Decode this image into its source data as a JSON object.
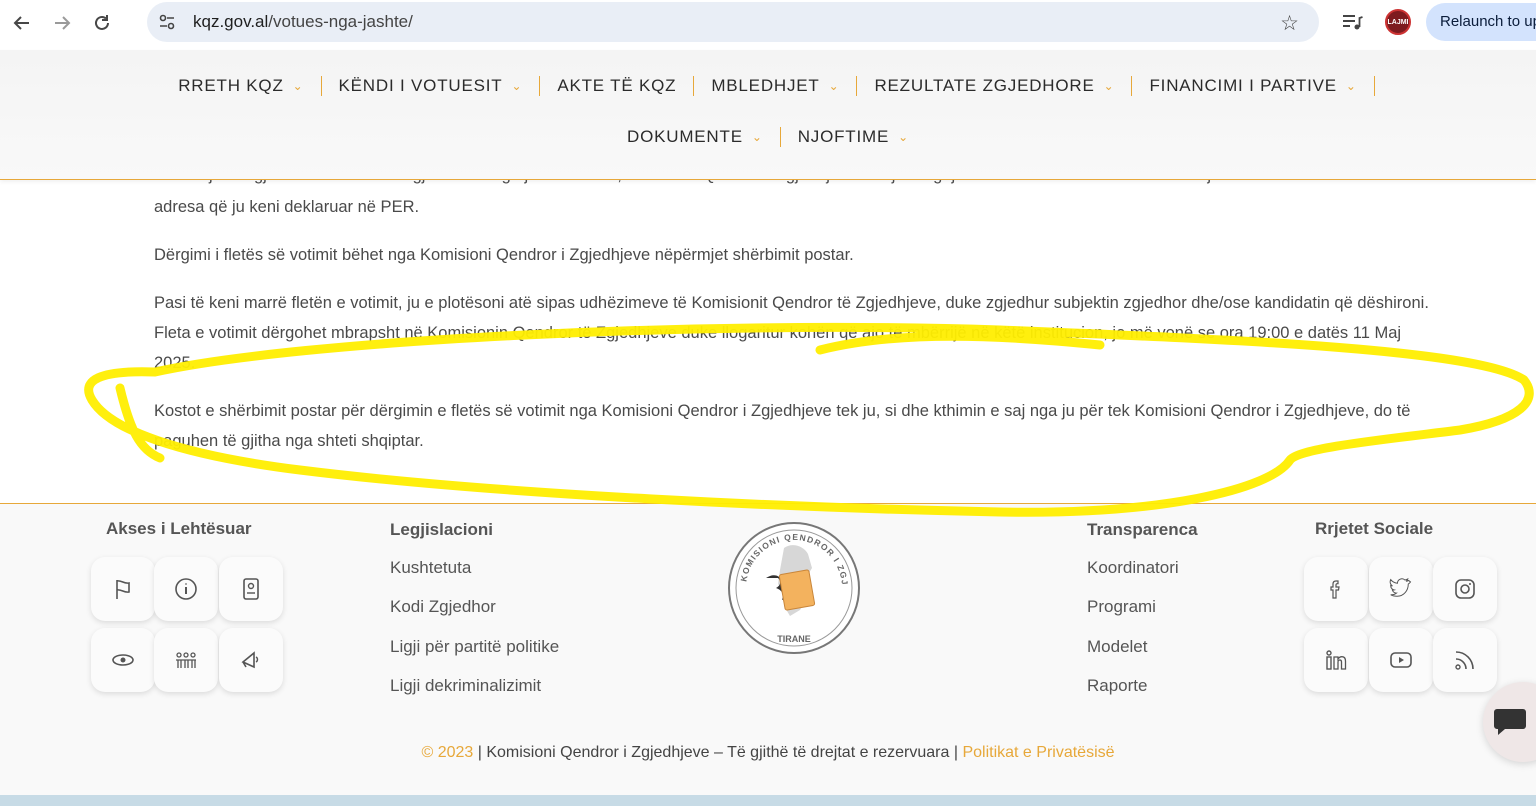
{
  "browser": {
    "url_domain": "kqz.gov.al",
    "url_path": "/votues-nga-jashte/",
    "ext_avatar_label": "LAJMI",
    "relaunch_label": "Relaunch to update"
  },
  "menu": {
    "row1": [
      {
        "label": "RRETH KQZ",
        "dropdown": true
      },
      {
        "label": "KËNDI I VOTUESIT",
        "dropdown": true
      },
      {
        "label": "AKTE TË KQZ",
        "dropdown": false
      },
      {
        "label": "MBLEDHJET",
        "dropdown": true
      },
      {
        "label": "REZULTATE ZGJEDHORE",
        "dropdown": true
      },
      {
        "label": "FINANCIMI I PARTIVE",
        "dropdown": true
      }
    ],
    "row2": [
      {
        "label": "DOKUMENTE",
        "dropdown": true
      },
      {
        "label": "NJOFTIME",
        "dropdown": true
      }
    ]
  },
  "content": {
    "p0_top": "Pasi të jeni regjistruar në Listën e Zgjedhësve nga jashtë vendit, Komisioni Qendror i Zgjedhjeve do t'ju dërgojë fletën e votimit dhe materiale të tjera udhëzuese tek",
    "p0_bottom": "adresa që ju keni deklaruar në PER.",
    "p1": "Dërgimi i fletës së votimit bëhet nga Komisioni Qendror i Zgjedhjeve nëpërmjet shërbimit postar.",
    "p2": "Pasi të keni marrë fletën e votimit, ju e plotësoni atë sipas udhëzimeve të Komisionit Qendror të Zgjedhjeve, duke zgjedhur subjektin zgjedhor dhe/ose kandidatin që dëshironi. Fleta e votimit dërgohet mbrapsht në Komisionin Qendror të Zgjedhjeve duke llogaritur kohën që ajo të mbërrijë në këtë institucion, jo më vonë se ora 19:00 e datës 11 Maj 2025.",
    "p3": "Kostot e shërbimit postar për dërgimin e fletës së votimit nga Komisioni Qendror i Zgjedhjeve tek ju, si dhe kthimin e saj nga ju për tek Komisioni Qendror i Zgjedhjeve, do të paguhen të gjitha nga shteti shqiptar."
  },
  "footer": {
    "accessibility_title": "Akses i Lehtësuar",
    "legislation_title": "Legjislacioni",
    "legislation_links": [
      "Kushtetuta",
      "Kodi Zgjedhor",
      "Ligji për partitë politike",
      "Ligji dekriminalizimit"
    ],
    "transparency_title": "Transparenca",
    "transparency_links": [
      "Koordinatori",
      "Programi",
      "Modelet",
      "Raporte"
    ],
    "social_title": "Rrjetet Sociale",
    "seal_text_top": "KOMISIONI QENDROR I ZGJEDHJEVE",
    "seal_text_bottom": "TIRANE",
    "copyright_year": "© 2023",
    "copyright_text": " | Komisioni Qendror i Zgjedhjeve – Të gjithë të drejtat e rezervuara | ",
    "privacy_link": "Politikat e Privatësisë"
  },
  "colors": {
    "accent": "#e7a83a",
    "annotation": "#ffee00"
  }
}
